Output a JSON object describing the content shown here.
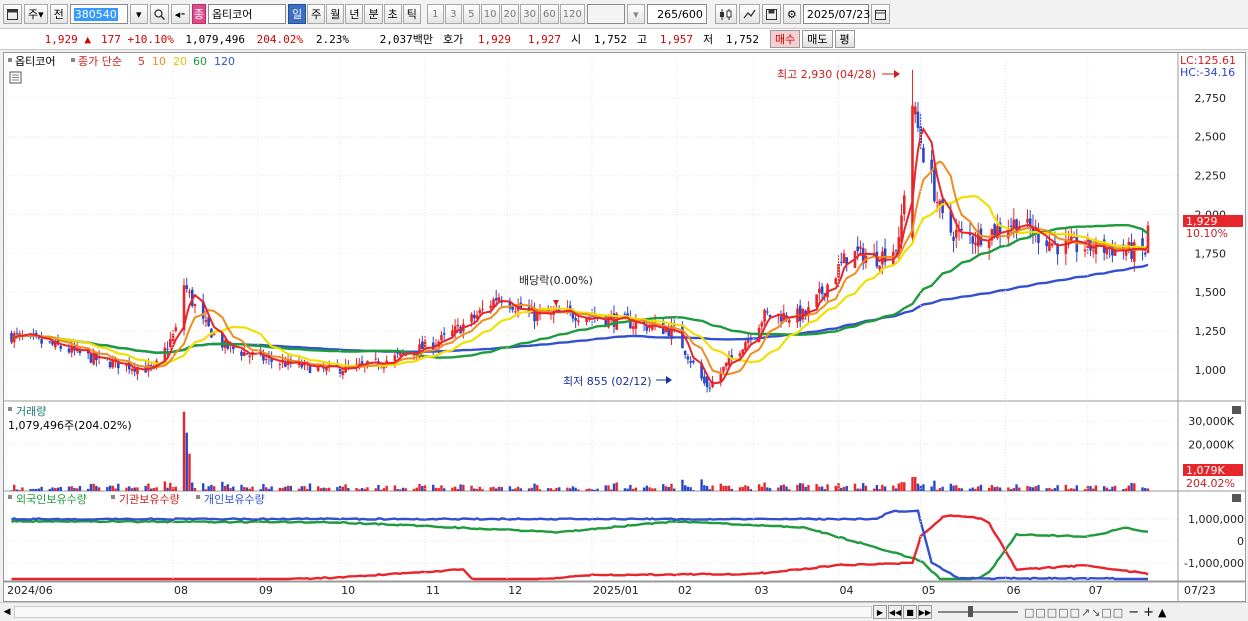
{
  "toolbar": {
    "type_label": "주",
    "prev_label": "전",
    "code": "380540",
    "stock_badge": "종",
    "stock_name": "옵티코어",
    "periods": [
      "일",
      "주",
      "월",
      "년",
      "분",
      "초",
      "틱"
    ],
    "period_selected": "일",
    "intervals": [
      "1",
      "3",
      "5",
      "10",
      "20",
      "30",
      "60",
      "120"
    ],
    "count_value": "265",
    "count_total": "/600",
    "date": "2025/07/23"
  },
  "quote": {
    "price": "1,929",
    "change": "177",
    "change_pct": "+10.10%",
    "volume": "1,079,496",
    "volume_ratio": "204.02%",
    "turnover": "2.23%",
    "amount": "2,037백만",
    "ask_label": "호가",
    "ask": "1,929",
    "bid": "1,927",
    "open_label": "시",
    "open": "1,752",
    "high_label": "고",
    "high": "1,957",
    "low_label": "저",
    "low": "1,752",
    "buy_label": "매수",
    "sell_label": "매도",
    "eval_label": "평"
  },
  "legend": {
    "stock": "옵티코어",
    "ma_label": "종가 단순",
    "ma_periods": [
      "5",
      "10",
      "20",
      "60",
      "120"
    ],
    "volume_title": "거래량",
    "volume_value": "1,079,496주(204.02%)",
    "foreign": "외국인보유수량",
    "institution": "기관보유수량",
    "individual": "개인보유수량"
  },
  "annotations": {
    "lc": "LC:125.61",
    "hc": "HC:-34.16",
    "high_marker": "최고 2,930 (04/28)",
    "low_marker": "최저 855 (02/12)",
    "dividend": "배당락(0.00%)",
    "price_tag": "1,929",
    "pct_tag": "10.10%",
    "vol_tag": "1,079K",
    "vol_pct_tag": "204.02%"
  },
  "colors": {
    "up": "#e8252a",
    "down": "#2a47c8",
    "ma5": "#e8252a",
    "ma10": "#f08c1e",
    "ma20": "#f0e000",
    "ma60": "#1f9a3c",
    "ma120": "#3350d0",
    "foreign": "#1f9a3c",
    "institution": "#e8252a",
    "individual": "#3350d0"
  },
  "chart_data": [
    {
      "type": "candlestick",
      "title": "옵티코어",
      "x_range": [
        "2024/06",
        "2025/07/23"
      ],
      "x_ticks": [
        "2024/06",
        "08",
        "09",
        "10",
        "11",
        "12",
        "2025/01",
        "02",
        "03",
        "04",
        "05",
        "06",
        "07",
        "07/23"
      ],
      "y_ticks": [
        "1,000",
        "1,250",
        "1,500",
        "1,750",
        "2,000",
        "2,250",
        "2,500",
        "2,750"
      ],
      "ylim": [
        800,
        3000
      ],
      "anchor_closes": [
        {
          "x": "2024/06/03",
          "y": 1220
        },
        {
          "x": "2024/06/20",
          "y": 1150
        },
        {
          "x": "2024/07/05",
          "y": 1060
        },
        {
          "x": "2024/07/25",
          "y": 1000
        },
        {
          "x": "2024/08/02",
          "y": 1250
        },
        {
          "x": "2024/08/05",
          "y": 1550
        },
        {
          "x": "2024/08/12",
          "y": 1300
        },
        {
          "x": "2024/08/20",
          "y": 1150
        },
        {
          "x": "2024/09/05",
          "y": 1060
        },
        {
          "x": "2024/09/25",
          "y": 1000
        },
        {
          "x": "2024/10/10",
          "y": 1020
        },
        {
          "x": "2024/10/25",
          "y": 1100
        },
        {
          "x": "2024/11/08",
          "y": 1200
        },
        {
          "x": "2024/11/20",
          "y": 1350
        },
        {
          "x": "2024/11/28",
          "y": 1480
        },
        {
          "x": "2024/12/10",
          "y": 1350
        },
        {
          "x": "2024/12/26",
          "y": 1360
        },
        {
          "x": "2025/01/10",
          "y": 1320
        },
        {
          "x": "2025/01/31",
          "y": 1250
        },
        {
          "x": "2025/02/12",
          "y": 880
        },
        {
          "x": "2025/02/20",
          "y": 1050
        },
        {
          "x": "2025/03/05",
          "y": 1350
        },
        {
          "x": "2025/03/20",
          "y": 1350
        },
        {
          "x": "2025/04/05",
          "y": 1750
        },
        {
          "x": "2025/04/15",
          "y": 1720
        },
        {
          "x": "2025/04/23",
          "y": 1800
        },
        {
          "x": "2025/04/28",
          "y": 2700
        },
        {
          "x": "2025/05/02",
          "y": 2400
        },
        {
          "x": "2025/05/10",
          "y": 1900
        },
        {
          "x": "2025/05/20",
          "y": 1850
        },
        {
          "x": "2025/06/05",
          "y": 1950
        },
        {
          "x": "2025/06/20",
          "y": 1800
        },
        {
          "x": "2025/07/10",
          "y": 1780
        },
        {
          "x": "2025/07/22",
          "y": 1752
        },
        {
          "x": "2025/07/23",
          "y": 1929
        }
      ],
      "high": {
        "date": "2025/04/28",
        "value": 2930
      },
      "low": {
        "date": "2025/02/12",
        "value": 855
      },
      "last": {
        "open": 1752,
        "high": 1957,
        "low": 1752,
        "close": 1929
      }
    },
    {
      "type": "bar",
      "title": "거래량",
      "y_ticks": [
        "20,000K",
        "30,000K"
      ],
      "last_value": 1079496
    },
    {
      "type": "line",
      "series": [
        {
          "name": "외국인보유수량"
        },
        {
          "name": "기관보유수량"
        },
        {
          "name": "개인보유수량"
        }
      ],
      "y_ticks": [
        "1,000,000",
        "0",
        "-1,000,000"
      ]
    }
  ]
}
